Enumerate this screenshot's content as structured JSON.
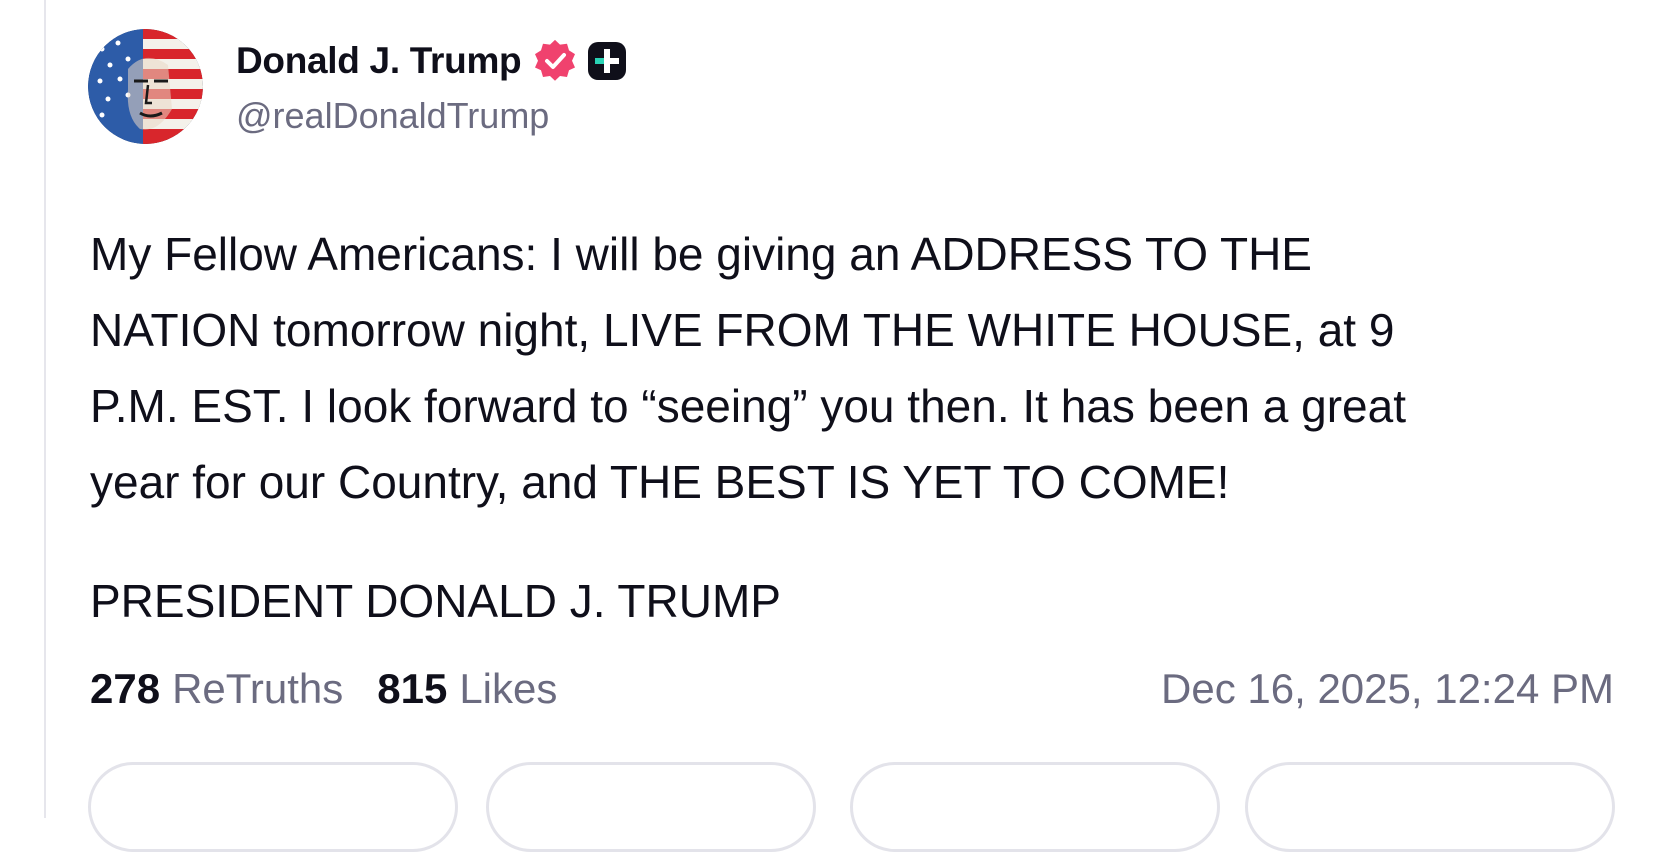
{
  "post": {
    "author": {
      "display_name": "Donald J. Trump",
      "handle": "@realDonaldTrump",
      "verified_icon": "verified-badge-icon",
      "plus_icon": "plus-badge-icon"
    },
    "body_lines": [
      "My Fellow Americans: I will be giving an ADDRESS TO THE",
      "NATION tomorrow night, LIVE FROM THE WHITE HOUSE, at 9",
      "P.M. EST. I look forward to “seeing” you then. It has been a great",
      "year for our Country, and THE BEST IS YET TO COME!"
    ],
    "signature": "PRESIDENT DONALD J. TRUMP",
    "stats": {
      "retruths_count": "278",
      "retruths_label": "ReTruths",
      "likes_count": "815",
      "likes_label": "Likes"
    },
    "timestamp": "Dec 16, 2025, 12:24 PM"
  },
  "colors": {
    "verified": "#f0426e",
    "text_primary": "#0f0f1a",
    "text_secondary": "#6b6b80",
    "border": "#e3e3ea"
  }
}
